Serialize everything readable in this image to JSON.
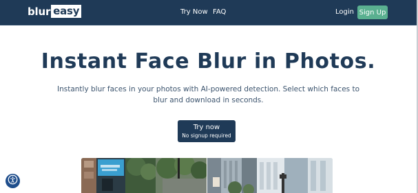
{
  "nav": {
    "logo_part1": "blur",
    "logo_part2": "easy",
    "links": [
      "Try Now",
      "FAQ"
    ],
    "login": "Login",
    "signup": "Sign Up"
  },
  "hero": {
    "title": "Instant Face Blur in Photos.",
    "subtitle": "Instantly blur faces in your photos with AI-powered detection. Select which faces to blur and download in seconds.",
    "cta_main": "Try now",
    "cta_sub": "No signup required"
  },
  "accessibility": {
    "icon": "accessibility-icon"
  },
  "colors": {
    "navy": "#1f3a57",
    "green": "#5ab090",
    "accessibility_blue": "#1f4e8c"
  }
}
